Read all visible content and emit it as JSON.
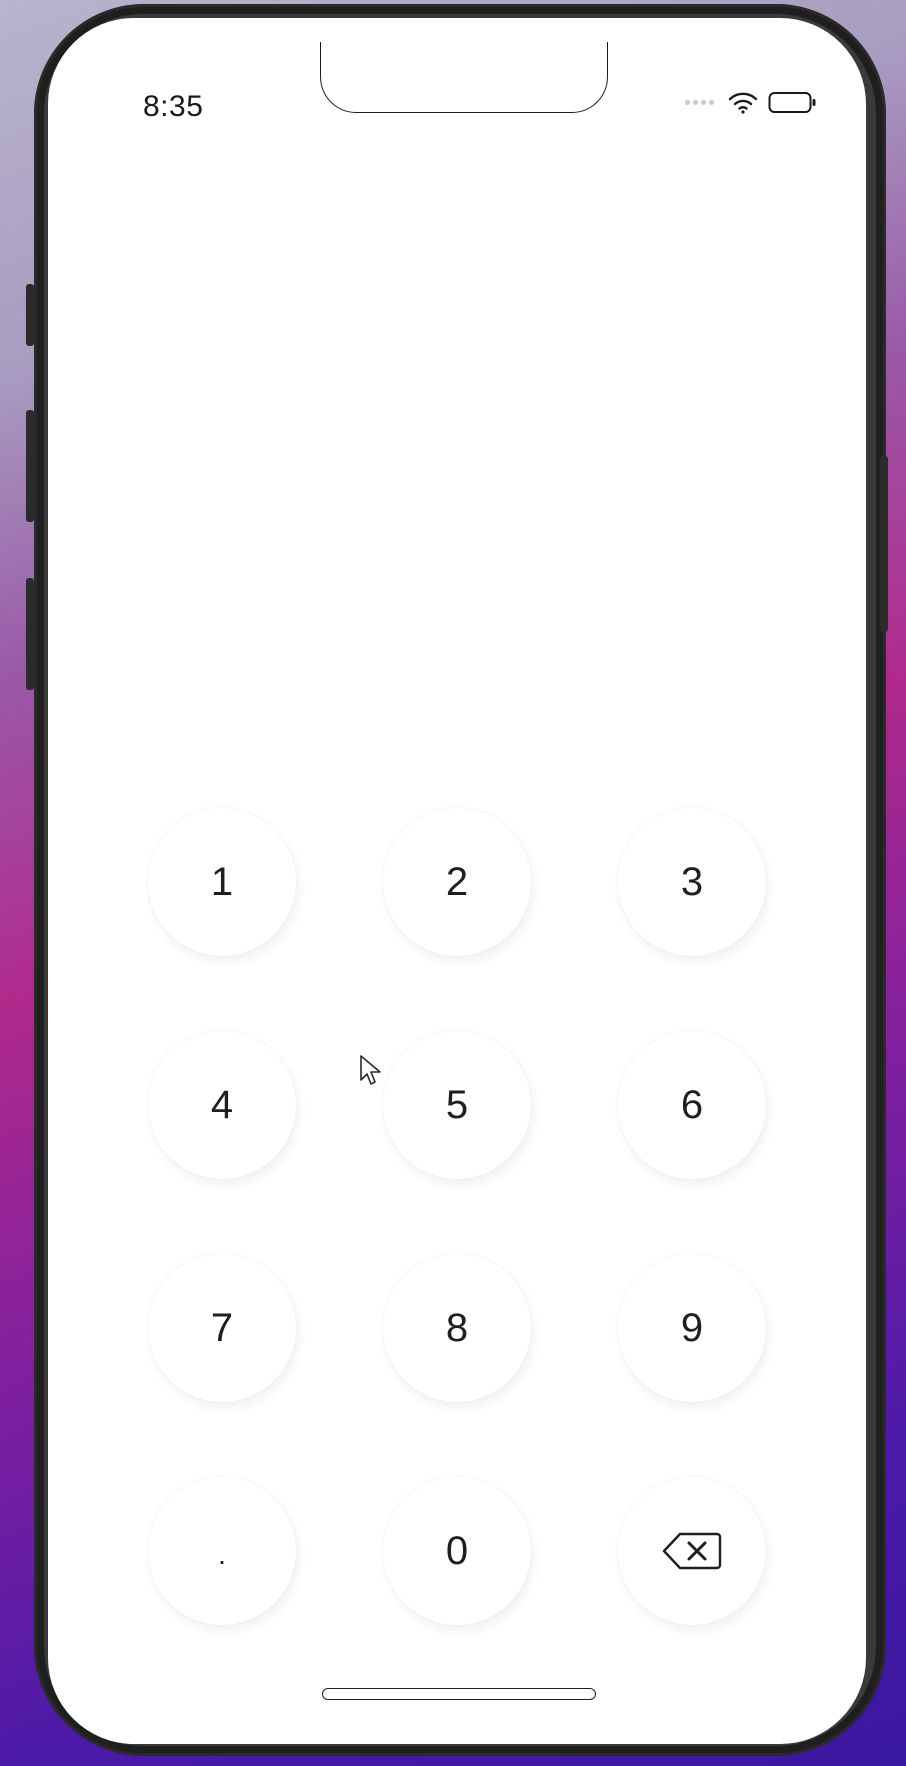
{
  "status_bar": {
    "time": "8:35"
  },
  "keypad": {
    "keys": [
      "1",
      "2",
      "3",
      "4",
      "5",
      "6",
      "7",
      "8",
      "9",
      ".",
      "0",
      "backspace"
    ],
    "k1": "1",
    "k2": "2",
    "k3": "3",
    "k4": "4",
    "k5": "5",
    "k6": "6",
    "k7": "7",
    "k8": "8",
    "k9": "9",
    "kdot": ".",
    "k0": "0",
    "backspace_icon": "delete-left-icon"
  },
  "colors": {
    "background": "#ffffff",
    "key_text": "#1f1f1f"
  }
}
